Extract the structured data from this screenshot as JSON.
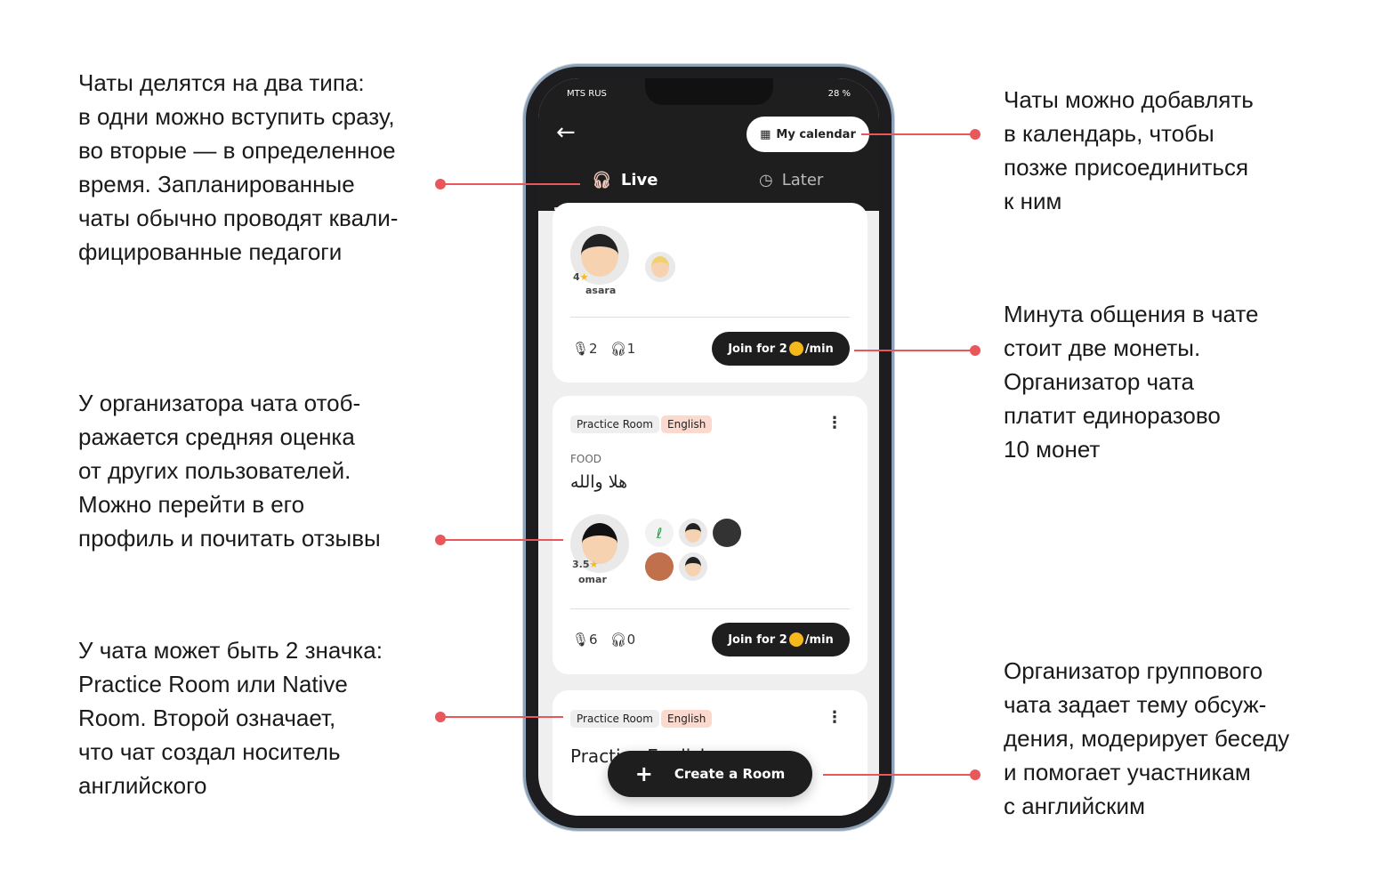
{
  "annotations": {
    "left": [
      "Чаты делятся на два типа:\nв одни можно вступить сразу,\nво вторые — в определенное\nвремя. Запланированные\nчаты обычно проводят квали-\nфицированные педагоги",
      "У организатора чата отоб-\nражается средняя оценка\nот других пользователей.\nМожно перейти в его\nпрофиль и почитать отзывы",
      "У чата может быть 2 значка:\nPractice Room или Native\nRoom. Второй означает,\nчто чат создал носитель\nанглийского"
    ],
    "right": [
      "Чаты можно добавлять\nв календарь, чтобы\nпозже присоединиться\nк ним",
      "Минута общения в чате\nстоит две монеты.\nОрганизатор чата\nплатит единоразово\n10 монет",
      "Организатор группового\nчата задает тему обсуж-\nдения, модерирует беседу\nи помогает участникам\nс английским"
    ]
  },
  "accent_color": "#e8585a",
  "status_bar": {
    "carrier": "MTS RUS",
    "battery": "28 %"
  },
  "header": {
    "back_icon": "arrow-left-icon",
    "calendar_label": "My calendar"
  },
  "tabs": [
    {
      "label": "Live",
      "icon": "headphones-icon",
      "active": true
    },
    {
      "label": "Later",
      "icon": "clock-icon",
      "active": false
    }
  ],
  "rooms": [
    {
      "host": "asara",
      "rating": "4",
      "speakers": "2",
      "listeners": "1",
      "join_label": "Join for 2",
      "join_suffix": "/min"
    },
    {
      "tags": [
        "Practice Room",
        "English"
      ],
      "category": "FOOD",
      "title": "هلا والله",
      "host": "omar",
      "rating": "3.5",
      "speakers": "6",
      "listeners": "0",
      "join_label": "Join for 2",
      "join_suffix": "/min"
    },
    {
      "tags": [
        "Practice Room",
        "English"
      ],
      "title": "Practice English"
    }
  ],
  "create_button": "Create a Room"
}
